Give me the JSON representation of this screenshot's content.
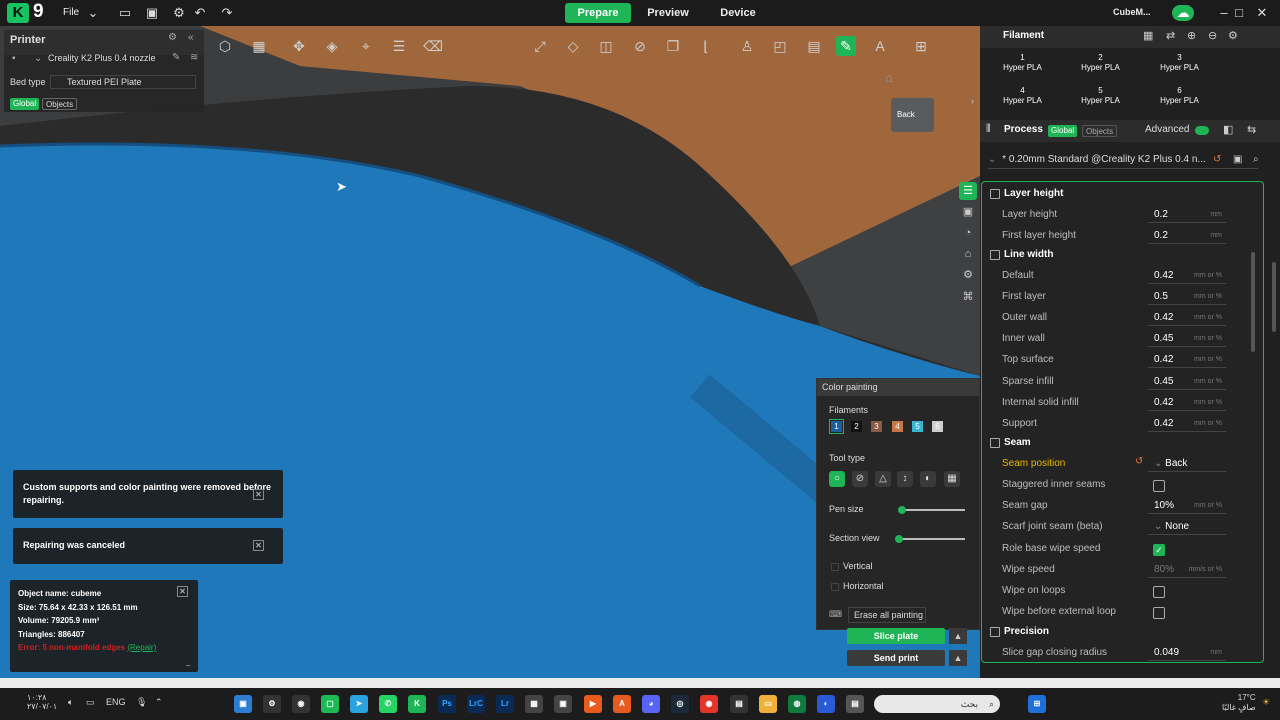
{
  "app": {
    "logo": "K",
    "version_badge": "9",
    "file_menu": "File",
    "window_title": "CubeM..."
  },
  "nav": {
    "prepare": "Prepare",
    "preview": "Preview",
    "device": "Device"
  },
  "printer": {
    "title": "Printer",
    "model": "Creality K2 Plus 0.4 nozzle",
    "bed_type_label": "Bed type",
    "bed_type_value": "Textured PEI Plate",
    "global": "Global",
    "objects": "Objects"
  },
  "viewport": {
    "back_label": "Back"
  },
  "notifications": [
    {
      "text": "Custom supports and color painting were removed before repairing."
    },
    {
      "text": "Repairing was canceled"
    }
  ],
  "object_info": {
    "name": "Object name: cubeme",
    "size": "Size: 75.64 x 42.33 x 126.51 mm",
    "volume": "Volume: 79205.9 mm³",
    "triangles": "Triangles: 886407",
    "errors": "Error: 5 non-manifold edges",
    "repair": "(Repair)"
  },
  "color_painting": {
    "title": "Color painting",
    "filaments_label": "Filaments",
    "swatches": [
      "1",
      "2",
      "3",
      "4",
      "5",
      "6"
    ],
    "swatch_colors": [
      "#1a5fa0",
      "#111111",
      "#8a5a44",
      "#c8754a",
      "#39b7d2",
      "#cfcfcf"
    ],
    "tool_type_label": "Tool type",
    "pen_size_label": "Pen size",
    "pen_size_value": 0.05,
    "section_view_label": "Section view",
    "section_view_value": 0.0,
    "vertical": "Vertical",
    "horizontal": "Horizontal",
    "erase_all": "Erase all painting"
  },
  "actions": {
    "slice_plate": "Slice plate",
    "send_print": "Send print"
  },
  "filament": {
    "title": "Filament",
    "cards": [
      {
        "num": "1",
        "name": "Hyper PLA",
        "color": "#1a5fa0"
      },
      {
        "num": "2",
        "name": "Hyper PLA",
        "color": "#111111"
      },
      {
        "num": "3",
        "name": "Hyper PLA",
        "color": "#8a5a44"
      },
      {
        "num": "4",
        "name": "Hyper PLA",
        "color": "#c8754a"
      },
      {
        "num": "5",
        "name": "Hyper PLA",
        "color": "#39b7d2"
      },
      {
        "num": "6",
        "name": "Hyper PLA",
        "color": "#cfcfcf"
      }
    ]
  },
  "process": {
    "title": "Process",
    "global": "Global",
    "objects": "Objects",
    "advanced": "Advanced",
    "preset": "* 0.20mm Standard @Creality K2 Plus 0.4 n..."
  },
  "params": {
    "layer_height_section": "Layer height",
    "layer_height": {
      "label": "Layer height",
      "value": "0.2",
      "unit": "mm"
    },
    "first_layer_height": {
      "label": "First layer height",
      "value": "0.2",
      "unit": "mm"
    },
    "line_width_section": "Line width",
    "default": {
      "label": "Default",
      "value": "0.42",
      "unit": "mm or %"
    },
    "first_layer": {
      "label": "First layer",
      "value": "0.5",
      "unit": "mm or %"
    },
    "outer_wall": {
      "label": "Outer wall",
      "value": "0.42",
      "unit": "mm or %"
    },
    "inner_wall": {
      "label": "Inner wall",
      "value": "0.45",
      "unit": "mm or %"
    },
    "top_surface": {
      "label": "Top surface",
      "value": "0.42",
      "unit": "mm or %"
    },
    "sparse_infill": {
      "label": "Sparse infill",
      "value": "0.45",
      "unit": "mm or %"
    },
    "internal_solid_infill": {
      "label": "Internal solid infill",
      "value": "0.42",
      "unit": "mm or %"
    },
    "support": {
      "label": "Support",
      "value": "0.42",
      "unit": "mm or %"
    },
    "seam_section": "Seam",
    "seam_position": {
      "label": "Seam position",
      "value": "Back"
    },
    "staggered_inner_seams": {
      "label": "Staggered inner seams"
    },
    "seam_gap": {
      "label": "Seam gap",
      "value": "10%",
      "unit": "mm or %"
    },
    "scarf_joint_seam": {
      "label": "Scarf joint seam (beta)",
      "value": "None"
    },
    "role_base_wipe_speed": {
      "label": "Role base wipe speed"
    },
    "wipe_speed": {
      "label": "Wipe speed",
      "value": "80%",
      "unit": "mm/s or %"
    },
    "wipe_on_loops": {
      "label": "Wipe on loops"
    },
    "wipe_before_external_loop": {
      "label": "Wipe before external loop"
    },
    "precision_section": "Precision",
    "slice_gap_closing_radius": {
      "label": "Slice gap closing radius",
      "value": "0.049",
      "unit": "mm"
    }
  },
  "taskbar": {
    "lang": "ENG",
    "weather_temp": "17°C",
    "weather_text": "صافٍ غالبًا",
    "search": "بحث",
    "date": "٢٧/٠٧/٠١",
    "time": "١٠:٢٨"
  }
}
